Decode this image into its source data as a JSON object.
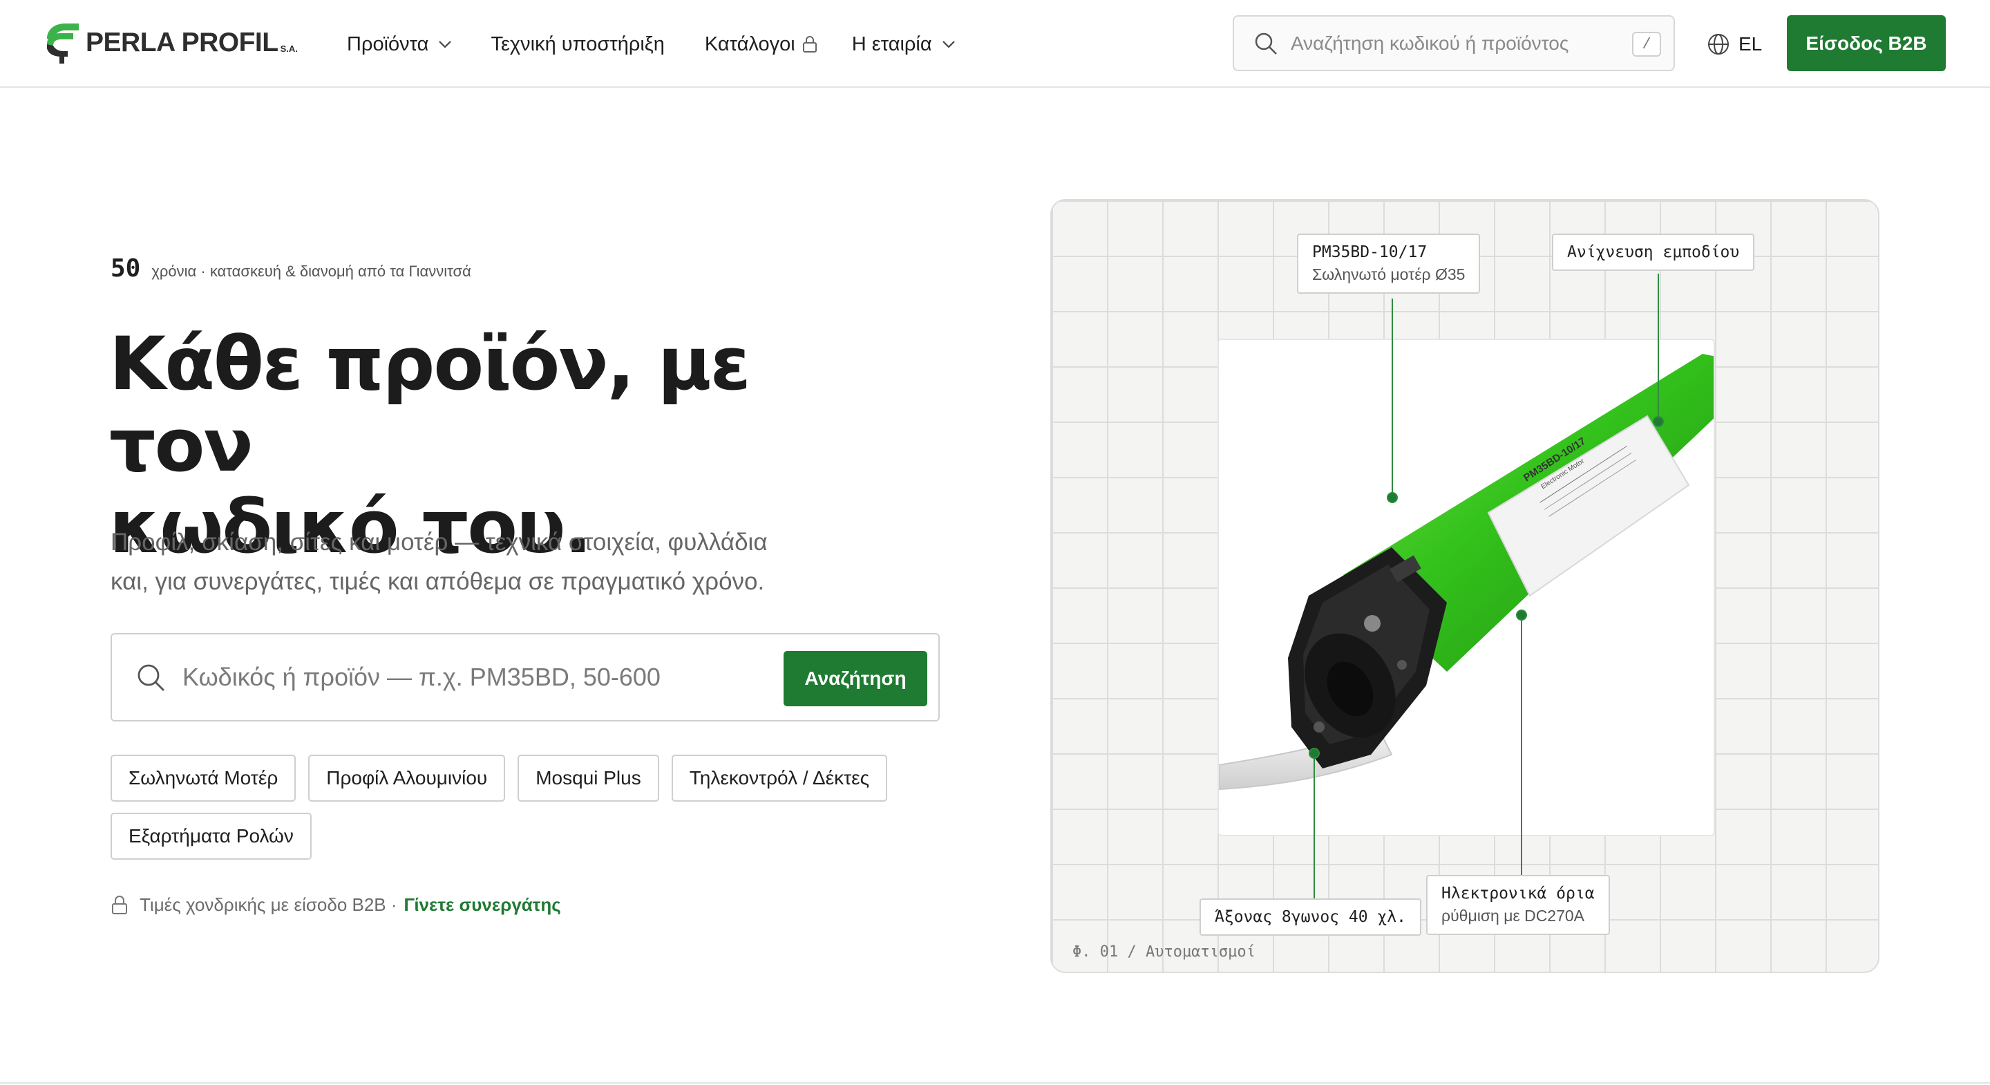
{
  "brand": {
    "name": "PERLA PROFIL",
    "suffix": "S.A.",
    "accent_color": "#1f7a32",
    "logo_green": "#3bb24a"
  },
  "nav": {
    "products": "Προϊόντα",
    "support": "Τεχνική υποστήριξη",
    "catalogs": "Κατάλογοι",
    "company": "Η εταιρία"
  },
  "top_search": {
    "placeholder": "Αναζήτηση κωδικού ή προϊόντος",
    "shortcut": "/"
  },
  "lang": {
    "code": "EL"
  },
  "b2b_login": "Είσοδος B2B",
  "hero": {
    "years": "50",
    "eyebrow": "χρόνια · κατασκευή & διανομή από τα Γιαννιτσά",
    "title_line1": "Κάθε προϊόν, με τον",
    "title_line2": "κωδικό του.",
    "subtitle_line1": "Προφίλ, σκίαση, σίτες και μοτέρ — τεχνικά στοιχεία, φυλλάδια",
    "subtitle_line2": "και, για συνεργάτες, τιμές και απόθεμα σε πραγματικό χρόνο.",
    "search_placeholder": "Κωδικός ή προϊόν — π.χ. PM35BD, 50-600",
    "search_button": "Αναζήτηση",
    "chips": [
      "Σωληνωτά Μοτέρ",
      "Προφίλ Αλουμινίου",
      "Mosqui Plus",
      "Τηλεκοντρόλ / Δέκτες",
      "Εξαρτήματα Ρολών"
    ],
    "b2b_note": "Τιμές χονδρικής με είσοδο B2B ·",
    "b2b_link": "Γίνετε συνεργάτης"
  },
  "figure": {
    "callout_model_title": "PM35BD-10/17",
    "callout_model_sub": "Σωληνωτό μοτέρ Ø35",
    "callout_obstacle": "Ανίχνευση εμποδίου",
    "callout_axis": "Άξονας 8γωνος 40 χλ.",
    "callout_limits_title": "Ηλεκτρονικά όρια",
    "callout_limits_sub": "ρύθμιση με DC270A",
    "caption": "Φ. 01 / Αυτοματισμοί",
    "label_model": "PM35BD-10/17",
    "label_sub": "Electronic Motor"
  }
}
